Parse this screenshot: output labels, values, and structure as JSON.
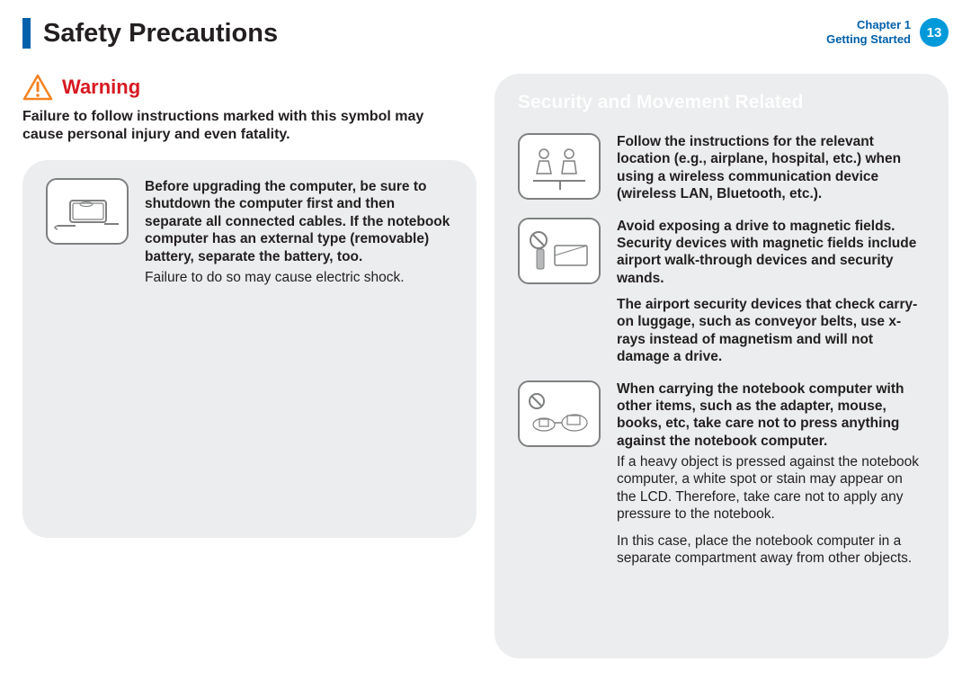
{
  "header": {
    "title": "Safety Precautions",
    "chapter_line1": "Chapter 1",
    "chapter_line2": "Getting Started",
    "page_number": "13"
  },
  "left": {
    "warning_label": "Warning",
    "warning_desc": "Failure to follow instructions marked with this symbol may cause personal injury and even fatality.",
    "items": [
      {
        "bold": "Before upgrading the computer, be sure to shutdown the computer first and then separate all connected cables. If the notebook computer has an external type (removable) battery, separate the battery, too.",
        "para": "Failure to do so may cause electric shock."
      }
    ]
  },
  "right": {
    "section_heading": "Security and Movement Related",
    "items": [
      {
        "bold": "Follow the instructions for the relevant location (e.g., airplane, hospital, etc.) when using a wireless communication device (wireless LAN, Bluetooth, etc.)."
      },
      {
        "bold": "Avoid exposing a drive to magnetic fields. Security devices with magnetic fields include airport walk-through devices and security wands.",
        "bold2": "The airport security devices that check carry-on luggage, such as conveyor belts, use x-rays instead of magnetism and will not damage a drive."
      },
      {
        "bold": "When carrying the notebook computer with other items, such as the adapter, mouse, books, etc, take care not to press anything against the notebook computer.",
        "para": "If a heavy object is pressed against the notebook computer, a white spot or stain may appear on the LCD. Therefore, take care not to apply any pressure to the notebook.",
        "para2": "In this case, place the notebook computer in a separate compartment away from other objects."
      }
    ]
  }
}
